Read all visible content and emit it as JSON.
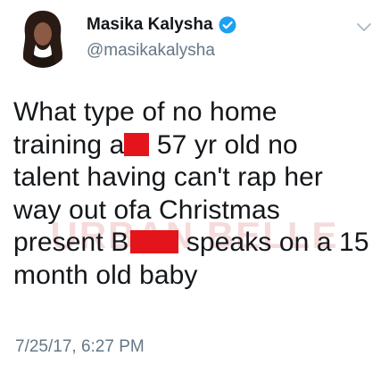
{
  "user": {
    "display_name": "Masika Kalysha",
    "handle": "@masikakalysha",
    "verified": true
  },
  "icons": {
    "verified": "verified-badge-icon",
    "menu": "chevron-down-icon"
  },
  "tweet": {
    "line1": "What type of no home",
    "line2_start": "training a",
    "line2_end": " 57 yr old no",
    "line3": "talent having can't rap her",
    "line4": "way out ofa Christmas",
    "line5_start": "present B",
    "line5_end": " speaks on a 15",
    "line6": "month old baby",
    "timestamp": "7/25/17, 6:27 PM"
  },
  "watermark": "URBAN BELLE",
  "colors": {
    "verified_blue": "#1da1f2",
    "text": "#14171a",
    "secondary": "#657786",
    "censor_red": "#e3141b"
  }
}
